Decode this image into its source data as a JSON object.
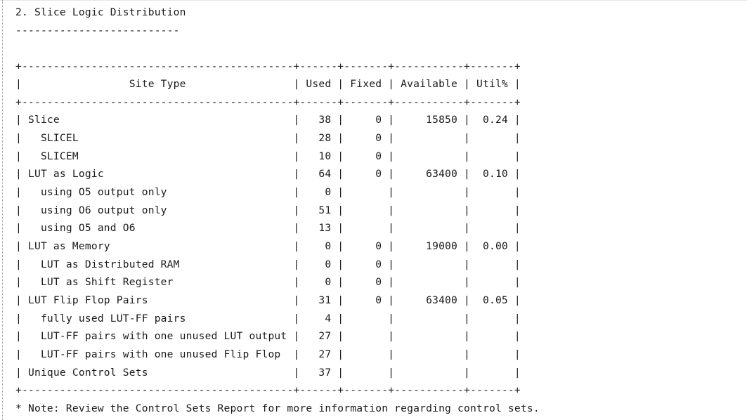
{
  "report": {
    "section_title": "2. Slice Logic Distribution",
    "section_underline": "--------------------------",
    "table_border": "+-------------------------------------------+------+-------+-----------+-------+",
    "header_row": "|                 Site Type                 | Used | Fixed | Available | Util% |",
    "rows": [
      "| Slice                                     |   38 |     0 |     15850 |  0.24 |",
      "|   SLICEL                                  |   28 |     0 |           |       |",
      "|   SLICEM                                  |   10 |     0 |           |       |",
      "| LUT as Logic                              |   64 |     0 |     63400 |  0.10 |",
      "|   using O5 output only                    |    0 |       |           |       |",
      "|   using O6 output only                    |   51 |       |           |       |",
      "|   using O5 and O6                         |   13 |       |           |       |",
      "| LUT as Memory                             |    0 |     0 |     19000 |  0.00 |",
      "|   LUT as Distributed RAM                  |    0 |     0 |           |       |",
      "|   LUT as Shift Register                   |    0 |     0 |           |       |",
      "| LUT Flip Flop Pairs                       |   31 |     0 |     63400 |  0.05 |",
      "|   fully used LUT-FF pairs                 |    4 |       |           |       |",
      "|   LUT-FF pairs with one unused LUT output |   27 |       |           |       |",
      "|   LUT-FF pairs with one unused Flip Flop  |   27 |       |           |       |",
      "| Unique Control Sets                       |   37 |       |           |       |"
    ],
    "note": "* Note: Review the Control Sets Report for more information regarding control sets."
  }
}
